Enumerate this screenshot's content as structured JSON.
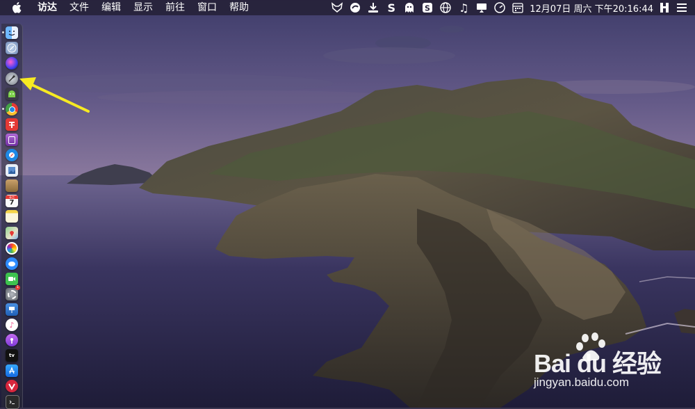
{
  "menubar": {
    "app_name": "访达",
    "menus": [
      "文件",
      "编辑",
      "显示",
      "前往",
      "窗口",
      "帮助"
    ],
    "status_icons": [
      "fox-icon",
      "disc-icon",
      "download-icon",
      "s-icon",
      "ghost-icon",
      "s-box-icon",
      "globe-icon",
      "music-note-icon",
      "monitor-icon",
      "speedometer-icon",
      "calendar-icon"
    ],
    "clock": "12月07日 周六 下午20:16:44"
  },
  "dock": {
    "apps": [
      {
        "name": "finder-icon",
        "color": "#3b8ff5"
      },
      {
        "name": "launchpad-icon",
        "color": "#8fa6c7"
      },
      {
        "name": "siri-icon",
        "color": "#5b4bd8"
      },
      {
        "name": "rocket-icon",
        "color": "#9aa0a8"
      },
      {
        "name": "android-icon",
        "color": "#4caf50"
      },
      {
        "name": "chrome-icon",
        "color": "#e53935"
      },
      {
        "name": "red-app-icon",
        "color": "#e53935"
      },
      {
        "name": "purple-app-icon",
        "color": "#8e44ad"
      },
      {
        "name": "safari-icon",
        "color": "#1e88e5"
      },
      {
        "name": "preview-icon",
        "color": "#5c8ecf"
      },
      {
        "name": "notebook-icon",
        "color": "#b8894a"
      },
      {
        "name": "calendar-icon",
        "color": "#f5f5f5"
      },
      {
        "name": "notes-icon",
        "color": "#f7f0c0"
      },
      {
        "name": "maps-icon",
        "color": "#6fb56f"
      },
      {
        "name": "photos-icon",
        "color": "#f0a030"
      },
      {
        "name": "messages-icon",
        "color": "#2f8cff"
      },
      {
        "name": "facetime-icon",
        "color": "#3ec24f"
      },
      {
        "name": "system-preferences-icon",
        "color": "#7b7f86"
      },
      {
        "name": "keynote-icon",
        "color": "#3d7fd8"
      },
      {
        "name": "itunes-icon",
        "color": "#f04c8c"
      },
      {
        "name": "podcasts-icon",
        "color": "#9b4fe0"
      },
      {
        "name": "apple-tv-icon",
        "color": "#111111"
      },
      {
        "name": "app-store-icon",
        "color": "#1f8cf0"
      },
      {
        "name": "vivaldi-icon",
        "color": "#d7263d"
      },
      {
        "name": "terminal-icon",
        "color": "#2a2a2a"
      }
    ],
    "calendar_day": "7",
    "calendar_month": "十二",
    "apple_tv_label": "tv",
    "sysprefs_badge": "1"
  },
  "annotation": {
    "arrow_color": "#f7ea22"
  },
  "watermark": {
    "logo_text": "Bai du 经验",
    "url": "jingyan.baidu.com"
  }
}
